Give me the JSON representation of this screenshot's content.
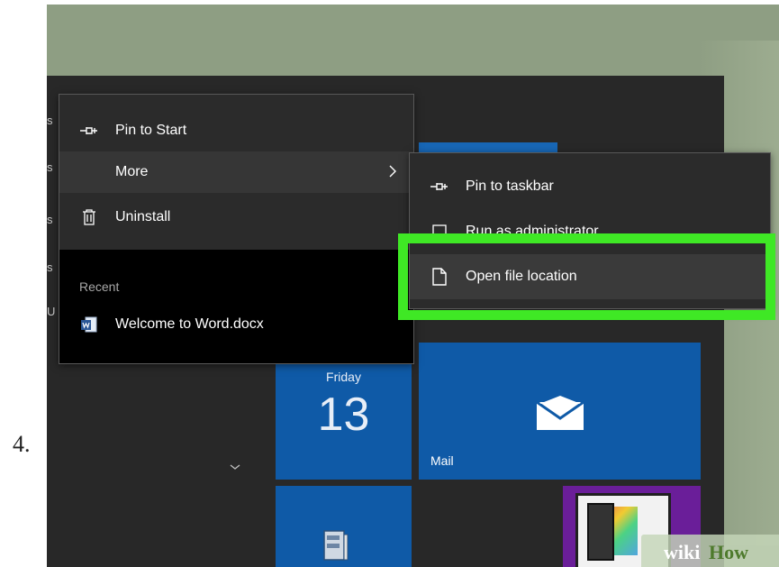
{
  "step_number": "4.",
  "start_menu": {
    "left_list_fragments": [
      "s",
      "s",
      "s",
      "s",
      "U"
    ],
    "expand_chevron": "chevron-down-icon"
  },
  "context_menu": {
    "items": [
      {
        "icon": "pin-icon",
        "label": "Pin to Start"
      },
      {
        "icon": "",
        "label": "More",
        "has_submenu": true
      },
      {
        "icon": "trash-icon",
        "label": "Uninstall"
      }
    ],
    "recent_heading": "Recent",
    "recent_items": [
      {
        "icon": "word-doc-icon",
        "label": "Welcome to Word.docx"
      }
    ]
  },
  "submenu": {
    "items": [
      {
        "icon": "pin-icon",
        "label": "Pin to taskbar"
      },
      {
        "icon": "shield-icon",
        "label": "Run as administrator"
      },
      {
        "icon": "file-icon",
        "label": "Open file location"
      }
    ]
  },
  "tiles": {
    "calendar": {
      "day": "Friday",
      "date": "13"
    },
    "mail": {
      "label": "Mail",
      "icon": "mail-icon"
    },
    "archive": {
      "icon": "archive-icon"
    },
    "photos": {
      "icon": "tablet-photos-icon"
    }
  },
  "watermark": {
    "wiki": "wiki",
    "how": "How"
  },
  "colors": {
    "highlight": "#3fe825",
    "tile_blue": "#0f5aa7",
    "menu_bg": "#2b2b2b",
    "start_bg": "#282828",
    "desktop": "#8e9e83",
    "tile_purple": "#6a1e99"
  }
}
